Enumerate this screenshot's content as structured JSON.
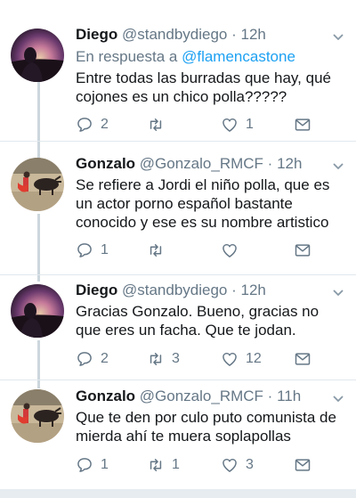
{
  "tweets": [
    {
      "name": "Diego",
      "handle": "@standbydiego",
      "dot": "·",
      "time": "12h",
      "reply_prefix": "En respuesta a",
      "reply_to": "@flamencastone",
      "text": "Entre todas las burradas que hay, qué cojones es un chico polla?????",
      "replies": "2",
      "retweets": "",
      "likes": "1",
      "avatar": "diego-avatar"
    },
    {
      "name": "Gonzalo",
      "handle": "@Gonzalo_RMCF",
      "dot": "·",
      "time": "12h",
      "text": "Se refiere a Jordi el niño polla, que es un actor porno español bastante conocido y ese es su nombre artistico",
      "replies": "1",
      "retweets": "",
      "likes": "",
      "avatar": "gonzalo-avatar"
    },
    {
      "name": "Diego",
      "handle": "@standbydiego",
      "dot": "·",
      "time": "12h",
      "text": "Gracias Gonzalo. Bueno, gracias no que eres un facha. Que te jodan.",
      "replies": "2",
      "retweets": "3",
      "likes": "12",
      "avatar": "diego-avatar"
    },
    {
      "name": "Gonzalo",
      "handle": "@Gonzalo_RMCF",
      "dot": "·",
      "time": "11h",
      "text": "Que te den por culo puto comunista de mierda ahí te muera soplapollas",
      "replies": "1",
      "retweets": "1",
      "likes": "3",
      "avatar": "gonzalo-avatar"
    }
  ],
  "icons": {
    "reply": "reply-icon",
    "retweet": "retweet-icon",
    "like": "heart-icon",
    "share": "mail-icon",
    "menu": "chevron-down-icon"
  },
  "colors": {
    "link": "#1da1f2",
    "muted": "#657786",
    "thread_line": "#ccd6dd"
  }
}
